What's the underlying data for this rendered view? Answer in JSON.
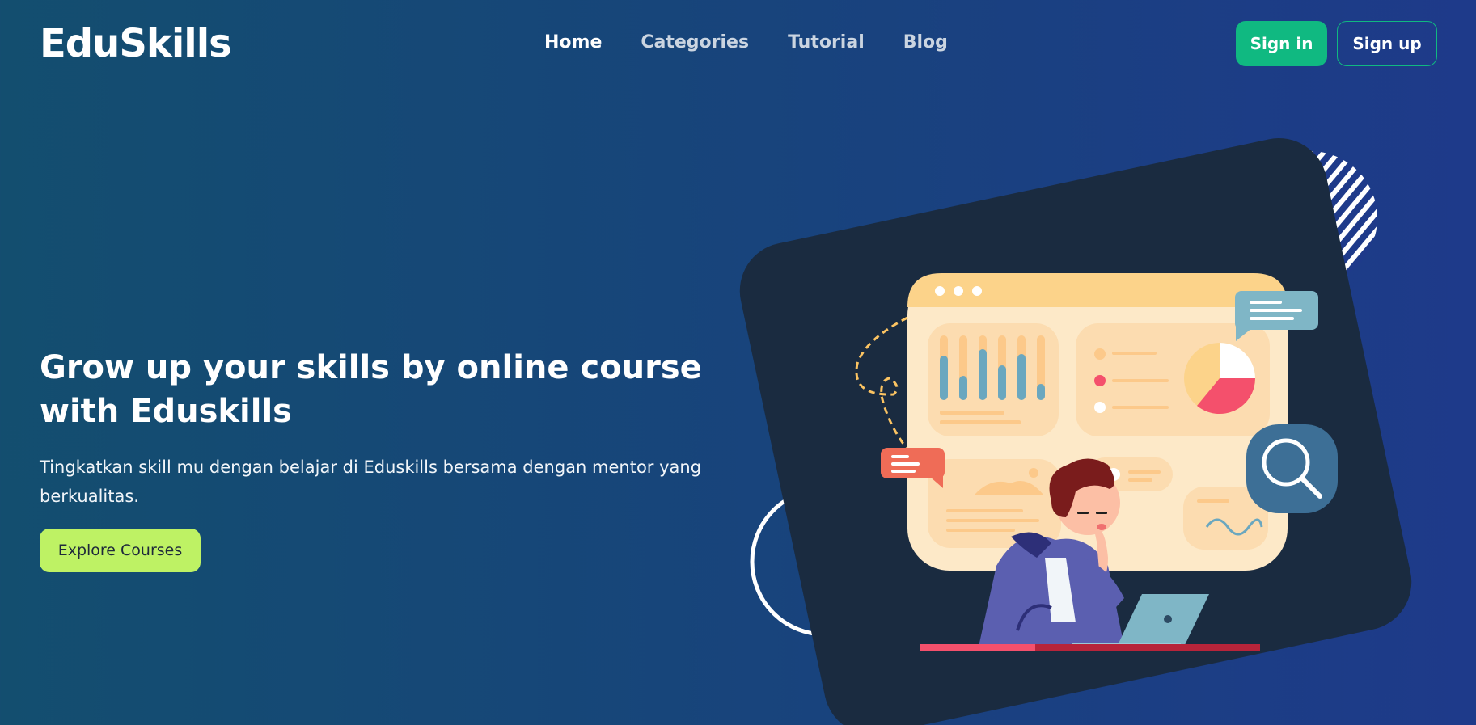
{
  "brand": {
    "name": "EduSkills"
  },
  "nav": {
    "items": [
      {
        "label": "Home",
        "active": true
      },
      {
        "label": "Categories",
        "active": false
      },
      {
        "label": "Tutorial",
        "active": false
      },
      {
        "label": "Blog",
        "active": false
      }
    ]
  },
  "auth": {
    "signin_label": "Sign in",
    "signup_label": "Sign up"
  },
  "hero": {
    "title": "Grow up your skills by online course with Eduskills",
    "subtitle": "Tingkatkan skill mu dengan belajar di Eduskills bersama dengan mentor yang berkualitas.",
    "cta_label": "Explore Courses"
  },
  "colors": {
    "accent_green": "#10b981",
    "cta_lime": "#bef264",
    "card_dark": "#1a2b40",
    "dashboard_cream": "#fde9c8",
    "chart_red": "#f4506c",
    "chart_blue": "#6aa7bf"
  },
  "illustration": {
    "icons": [
      "magnifier-icon",
      "chat-bubble-icon",
      "pie-chart-icon",
      "laptop-icon"
    ]
  }
}
